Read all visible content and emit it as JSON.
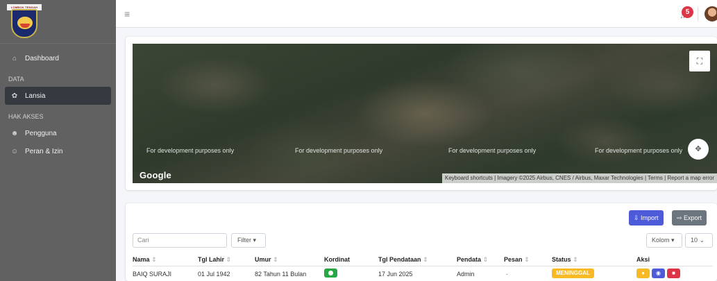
{
  "logo": {
    "banner": "LOMBOK TENGAH"
  },
  "sidebar": {
    "items": [
      {
        "label": "Dashboard",
        "icon": "home-icon"
      },
      {
        "heading": "DATA"
      },
      {
        "label": "Lansia",
        "icon": "elderly-icon",
        "active": true
      },
      {
        "heading": "HAK AKSES"
      },
      {
        "label": "Pengguna",
        "icon": "users-icon"
      },
      {
        "label": "Peran & Izin",
        "icon": "user-tag-icon"
      }
    ]
  },
  "topbar": {
    "notification_count": "5"
  },
  "map": {
    "watermark": "For development purposes only",
    "brand": "Google",
    "attribution": "Keyboard shortcuts | Imagery ©2025 Airbus, CNES / Airbus, Maxar Technologies | Terms | Report a map error"
  },
  "toolbar": {
    "import_label": "Import",
    "export_label": "Export",
    "search_placeholder": "Cari",
    "filter_label": "Filter",
    "columns_label": "Kolom",
    "per_page": "10"
  },
  "table": {
    "headers": [
      "Nama",
      "Tgl Lahir",
      "Umur",
      "Kordinat",
      "Tgl Pendataan",
      "Pendata",
      "Pesan",
      "Status",
      "Aksi"
    ],
    "rows": [
      {
        "nama": "BAIQ SURAJI",
        "tgl_lahir": "01 Jul 1942",
        "umur": "82 Tahun 11 Bulan",
        "tgl_pendataan": "17 Jun 2025",
        "pendata": "Admin",
        "pesan": "-",
        "status": "MENINGGAL"
      }
    ]
  },
  "colors": {
    "sidebar": "#616161",
    "active": "#343a40",
    "import": "#4e5bd8",
    "export": "#6c757d",
    "status_meninggal": "#f7b924",
    "action_location": "#f7b924",
    "action_view": "#4e5bd8",
    "action_delete": "#dc3545"
  }
}
